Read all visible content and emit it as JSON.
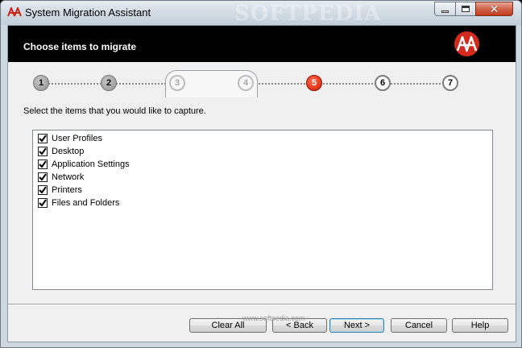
{
  "window": {
    "title": "System Migration Assistant",
    "watermark": "SOFTPEDIA",
    "controls": {
      "minimize_icon": "minimize-icon",
      "maximize_icon": "maximize-icon",
      "close_icon": "close-icon",
      "close_glyph": "✕"
    }
  },
  "header": {
    "title": "Choose items to migrate",
    "logo_icon": "sma-logo-icon",
    "accent": "#d32a1e"
  },
  "wizard": {
    "steps": [
      {
        "label": "1",
        "state": "done"
      },
      {
        "label": "2",
        "state": "done"
      },
      {
        "label": "3",
        "state": "skipped"
      },
      {
        "label": "4",
        "state": "skipped"
      },
      {
        "label": "5",
        "state": "current"
      },
      {
        "label": "6",
        "state": "future"
      },
      {
        "label": "7",
        "state": "future"
      }
    ],
    "current_color": "#d21b00"
  },
  "main": {
    "instruction": "Select the items that you would like to capture.",
    "items": [
      {
        "label": "User Profiles",
        "checked": true
      },
      {
        "label": "Desktop",
        "checked": true
      },
      {
        "label": "Application Settings",
        "checked": true
      },
      {
        "label": "Network",
        "checked": true
      },
      {
        "label": "Printers",
        "checked": true
      },
      {
        "label": "Files and Folders",
        "checked": true
      }
    ]
  },
  "footer": {
    "clear_all_label": "Clear All",
    "back_label": "< Back",
    "next_label": "Next >",
    "cancel_label": "Cancel",
    "help_label": "Help",
    "watermark": "www.softpedia.com"
  }
}
